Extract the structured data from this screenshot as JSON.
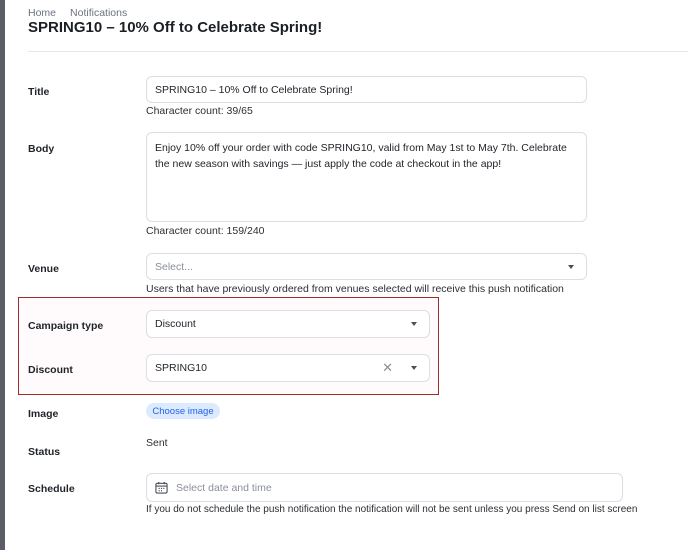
{
  "breadcrumb": {
    "home": "Home",
    "current": "Notifications"
  },
  "page_title": "SPRING10 – 10% Off to Celebrate Spring!",
  "fields": {
    "title": {
      "label": "Title",
      "value": "SPRING10 – 10% Off to Celebrate Spring!",
      "char_count": "Character count: 39/65"
    },
    "body": {
      "label": "Body",
      "value": "Enjoy 10% off your order with code SPRING10, valid from May 1st to May 7th. Celebrate the new season with savings — just apply the code at checkout in the app!",
      "char_count": "Character count: 159/240"
    },
    "venue": {
      "label": "Venue",
      "placeholder": "Select...",
      "hint": "Users that have previously ordered from venues selected will receive this push notification"
    },
    "campaign_type": {
      "label": "Campaign type",
      "value": "Discount"
    },
    "discount": {
      "label": "Discount",
      "value": "SPRING10",
      "clear_icon": "✕"
    },
    "image": {
      "label": "Image",
      "button": "Choose image"
    },
    "status": {
      "label": "Status",
      "value": "Sent"
    },
    "schedule": {
      "label": "Schedule",
      "placeholder": "Select date and time",
      "hint": "If you do not schedule the push notification the notification will not be sent unless you press Send on list screen"
    }
  },
  "colors": {
    "highlight_border": "#9c2f2a",
    "button_bg": "#dbeafe",
    "button_text": "#2563eb"
  },
  "icons": {
    "calendar": "calendar-icon",
    "dropdown": "chevron-down-icon",
    "clear": "close-icon"
  }
}
